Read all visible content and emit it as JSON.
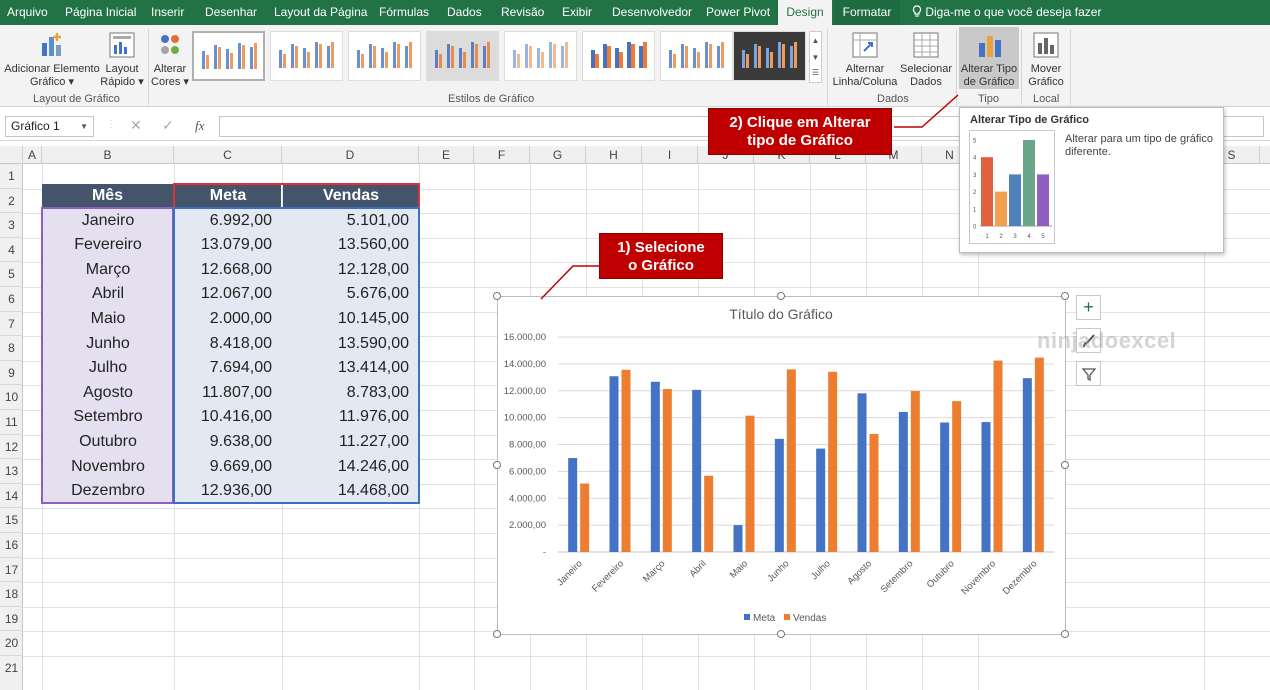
{
  "menubar": {
    "tabs": [
      "Arquivo",
      "Página Inicial",
      "Inserir",
      "Desenhar",
      "Layout da Página",
      "Fórmulas",
      "Dados",
      "Revisão",
      "Exibir",
      "Desenvolvedor",
      "Power Pivot",
      "Design",
      "Formatar"
    ],
    "tell_me": "Diga-me o que você deseja fazer"
  },
  "ribbon": {
    "add_element": [
      "Adicionar Elemento",
      "Gráfico ▾"
    ],
    "quick_layout": [
      "Layout",
      "Rápido ▾"
    ],
    "change_colors": [
      "Alterar",
      "Cores ▾"
    ],
    "switch_row_col": [
      "Alternar",
      "Linha/Coluna"
    ],
    "select_data": [
      "Selecionar",
      "Dados"
    ],
    "change_type": [
      "Alterar Tipo",
      "de Gráfico"
    ],
    "move_chart": [
      "Mover",
      "Gráfico"
    ],
    "groups": [
      "Layout de Gráfico",
      "Estilos de Gráfico",
      "Dados",
      "Tipo",
      "Local"
    ]
  },
  "formula_bar": {
    "name_box": "Gráfico 1",
    "fx": "fx"
  },
  "columns": [
    "A",
    "B",
    "C",
    "D",
    "E",
    "F",
    "G",
    "H",
    "I",
    "J",
    "K",
    "L",
    "M",
    "N",
    "S"
  ],
  "rows": [
    "1",
    "2",
    "3",
    "4",
    "5",
    "6",
    "7",
    "8",
    "9",
    "10",
    "11",
    "12",
    "13",
    "14",
    "15",
    "16",
    "17",
    "18",
    "19",
    "20",
    "21"
  ],
  "table": {
    "headers": [
      "Mês",
      "Meta",
      "Vendas"
    ],
    "rows": [
      [
        "Janeiro",
        "6.992,00",
        "5.101,00"
      ],
      [
        "Fevereiro",
        "13.079,00",
        "13.560,00"
      ],
      [
        "Março",
        "12.668,00",
        "12.128,00"
      ],
      [
        "Abril",
        "12.067,00",
        "5.676,00"
      ],
      [
        "Maio",
        "2.000,00",
        "10.145,00"
      ],
      [
        "Junho",
        "8.418,00",
        "13.590,00"
      ],
      [
        "Julho",
        "7.694,00",
        "13.414,00"
      ],
      [
        "Agosto",
        "11.807,00",
        "8.783,00"
      ],
      [
        "Setembro",
        "10.416,00",
        "11.976,00"
      ],
      [
        "Outubro",
        "9.638,00",
        "11.227,00"
      ],
      [
        "Novembro",
        "9.669,00",
        "14.246,00"
      ],
      [
        "Dezembro",
        "12.936,00",
        "14.468,00"
      ]
    ]
  },
  "callouts": {
    "step1": [
      "1) Selecione",
      "o Gráfico"
    ],
    "step2": [
      "2) Clique em Alterar",
      "tipo de Gráfico"
    ]
  },
  "tooltip": {
    "title": "Alterar Tipo de Gráfico",
    "desc": [
      "Alterar para um tipo de gráfico",
      "diferente."
    ],
    "mini_axis": [
      "5",
      "4",
      "3",
      "2",
      "1",
      "0"
    ],
    "mini_cats": [
      "1",
      "2",
      "3",
      "4",
      "5"
    ],
    "mini_values": [
      4,
      2,
      3,
      5,
      3
    ],
    "mini_colors": [
      "#e06040",
      "#f0a050",
      "#4f81bd",
      "#6aa78a",
      "#8e5fbf"
    ]
  },
  "watermark": "ninjadoexcel",
  "chart_data": {
    "type": "bar",
    "title": "Título do Gráfico",
    "categories": [
      "Janeiro",
      "Fevereiro",
      "Março",
      "Abril",
      "Maio",
      "Junho",
      "Julho",
      "Agosto",
      "Setembro",
      "Outubro",
      "Novembro",
      "Dezembro"
    ],
    "series": [
      {
        "name": "Meta",
        "color": "#4472c4",
        "values": [
          6992,
          13079,
          12668,
          12067,
          2000,
          8418,
          7694,
          11807,
          10416,
          9638,
          9669,
          12936
        ]
      },
      {
        "name": "Vendas",
        "color": "#ed7d31",
        "values": [
          5101,
          13560,
          12128,
          5676,
          10145,
          13590,
          13414,
          8783,
          11976,
          11227,
          14246,
          14468
        ]
      }
    ],
    "yticks": [
      "-",
      "2.000,00",
      "4.000,00",
      "6.000,00",
      "8.000,00",
      "10.000,00",
      "12.000,00",
      "14.000,00",
      "16.000,00"
    ],
    "ylim": [
      0,
      16000
    ],
    "grid": true,
    "legend": "bottom"
  }
}
